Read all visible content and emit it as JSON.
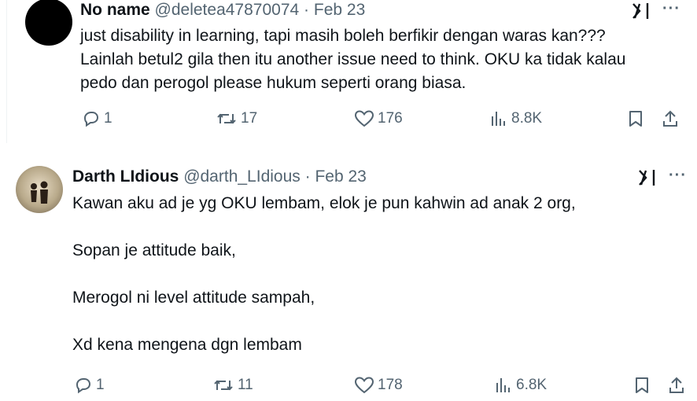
{
  "tweets": [
    {
      "name": "No name",
      "handle": "@deletea47870074",
      "separator": "·",
      "date": "Feb 23",
      "text": "just disability in learning, tapi masih boleh berfikir dengan waras kan???\nLainlah betul2 gila then itu another issue need to think. OKU ka tidak kalau\npedo dan perogol please hukum seperti orang biasa.",
      "replies": "1",
      "reposts": "17",
      "likes": "176",
      "views": "8.8K"
    },
    {
      "name": "Darth LIdious",
      "handle": "@darth_LIdious",
      "separator": "·",
      "date": "Feb 23",
      "text": "Kawan aku ad je yg OKU lembam, elok je pun kahwin ad anak 2 org,\n\nSopan je attitude baik,\n\nMerogol ni level attitude sampah,\n\nXd kena mengena dgn lembam",
      "replies": "1",
      "reposts": "11",
      "likes": "178",
      "views": "6.8K"
    }
  ],
  "icons": {
    "grok": "grok-icon",
    "more": "more-icon",
    "reply": "reply-icon",
    "repost": "repost-icon",
    "like": "like-icon",
    "views": "views-icon",
    "bookmark": "bookmark-icon",
    "share": "share-icon"
  },
  "colors": {
    "secondary": "#536471",
    "primary": "#0f1419"
  }
}
